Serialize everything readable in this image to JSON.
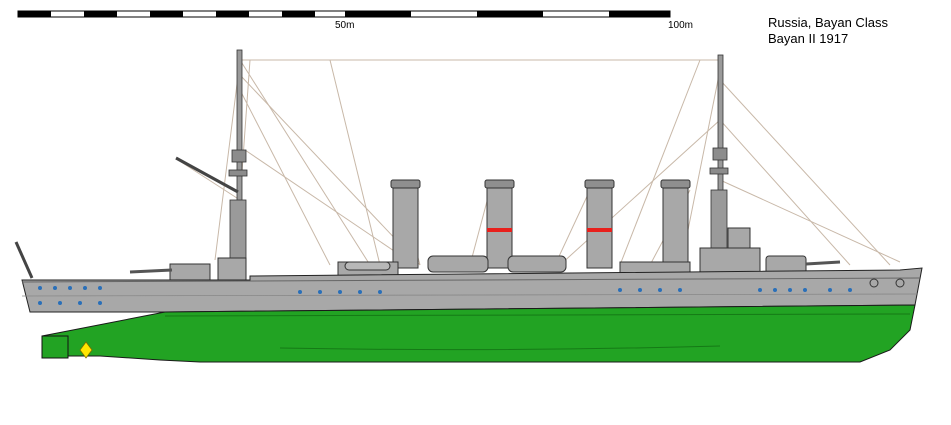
{
  "scale_bar": {
    "labels": [
      "50m",
      "100m"
    ]
  },
  "caption": {
    "line1": "Russia, Bayan Class",
    "line2": "Bayan II 1917"
  },
  "colors": {
    "hull_gray": "#a8a8a8",
    "hull_green": "#22a323",
    "funnel_band": "#e8201c",
    "outline": "#000000",
    "rigging": "#c8b8a8",
    "propeller": "#ffe600"
  }
}
